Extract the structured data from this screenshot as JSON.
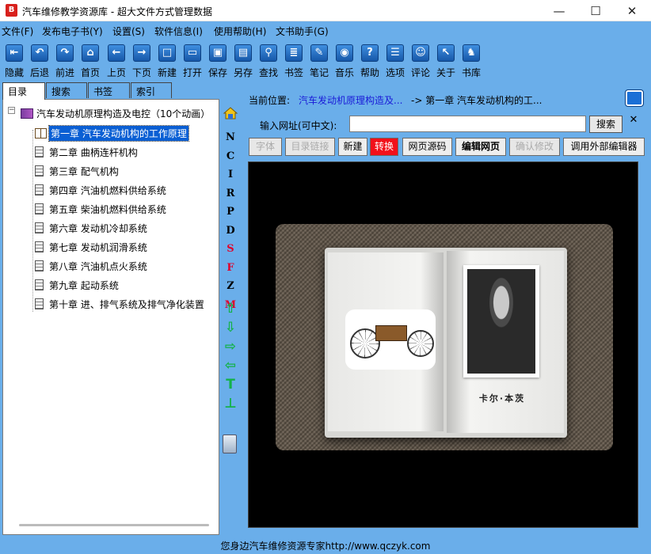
{
  "window": {
    "title": "汽车维修教学资源库 - 超大文件方式管理数据",
    "minimize": "—",
    "maximize": "☐",
    "close": "✕"
  },
  "menu": [
    "文件(F)",
    "发布电子书(Y)",
    "设置(S)",
    "软件信息(I)",
    "使用帮助(H)",
    "文书助手(G)"
  ],
  "toolbar": [
    {
      "label": "隐藏",
      "icon": "hide-icon",
      "glyph": "⇤"
    },
    {
      "label": "后退",
      "icon": "back-icon",
      "glyph": "↶"
    },
    {
      "label": "前进",
      "icon": "forward-icon",
      "glyph": "↷"
    },
    {
      "label": "首页",
      "icon": "home-icon",
      "glyph": "⌂"
    },
    {
      "label": "上页",
      "icon": "prev-page-icon",
      "glyph": "←"
    },
    {
      "label": "下页",
      "icon": "next-page-icon",
      "glyph": "→"
    },
    {
      "label": "新建",
      "icon": "new-icon",
      "glyph": "□"
    },
    {
      "label": "打开",
      "icon": "open-icon",
      "glyph": "▭"
    },
    {
      "label": "保存",
      "icon": "save-icon",
      "glyph": "▣"
    },
    {
      "label": "另存",
      "icon": "save-as-icon",
      "glyph": "▤"
    },
    {
      "label": "查找",
      "icon": "find-icon",
      "glyph": "⚲"
    },
    {
      "label": "书签",
      "icon": "bookmark-icon",
      "glyph": "≣"
    },
    {
      "label": "笔记",
      "icon": "note-icon",
      "glyph": "✎"
    },
    {
      "label": "音乐",
      "icon": "music-icon",
      "glyph": "◉"
    },
    {
      "label": "帮助",
      "icon": "help-icon",
      "glyph": "?"
    },
    {
      "label": "选项",
      "icon": "options-icon",
      "glyph": "☰"
    },
    {
      "label": "评论",
      "icon": "comment-icon",
      "glyph": "☺"
    },
    {
      "label": "关于",
      "icon": "about-icon",
      "glyph": "↖"
    },
    {
      "label": "书库",
      "icon": "library-icon",
      "glyph": "♞"
    }
  ],
  "left_tabs": [
    "目录",
    "搜索",
    "书签",
    "索引"
  ],
  "tree": {
    "root": "汽车发动机原理构造及电控（10个动画）",
    "items": [
      "第一章 汽车发动机构的工作原理",
      "第二章 曲柄连杆机构",
      "第三章 配气机构",
      "第四章 汽油机燃料供给系统",
      "第五章 柴油机燃料供给系统",
      "第六章 发动机冷却系统",
      "第七章 发动机润滑系统",
      "第八章 汽油机点火系统",
      "第九章 起动系统",
      "第十章 进、排气系统及排气净化装置"
    ],
    "selected_index": 0
  },
  "strip": {
    "letters": [
      "N",
      "C",
      "I",
      "R",
      "P",
      "D",
      "S",
      "F",
      "Z",
      "M"
    ],
    "red_letters": [
      "S",
      "F",
      "M"
    ],
    "arrows": [
      "⇧",
      "⇩",
      "⇨",
      "⇦",
      "T",
      "⊥"
    ]
  },
  "location": {
    "label": "当前位置:",
    "link": "汽车发动机原理构造及...",
    "rest": "-> 第一章 汽车发动机构的工..."
  },
  "url": {
    "label": "输入网址(可中文):",
    "value": "",
    "search": "搜索",
    "close": "✕"
  },
  "editor_buttons": [
    {
      "label": "字体",
      "state": "disabled"
    },
    {
      "label": "目录链接",
      "state": "disabled"
    },
    {
      "label": "新建",
      "state": "normal"
    },
    {
      "label": "转换",
      "state": "red"
    },
    {
      "label": "网页源码",
      "state": "normal"
    },
    {
      "label": "编辑网页",
      "state": "bold"
    },
    {
      "label": "确认修改",
      "state": "disabled"
    },
    {
      "label": "调用外部编辑器",
      "state": "normal"
    }
  ],
  "content": {
    "caption": "卡尔·本茨"
  },
  "status": "您身边汽车维修资源专家http://www.qczyk.com",
  "colors": {
    "chrome_blue": "#6aaeea",
    "selection": "#0a5fd4",
    "accent_red": "#f2101a",
    "link_blue": "#1a1ad8",
    "arrow_green": "#14b24a"
  }
}
